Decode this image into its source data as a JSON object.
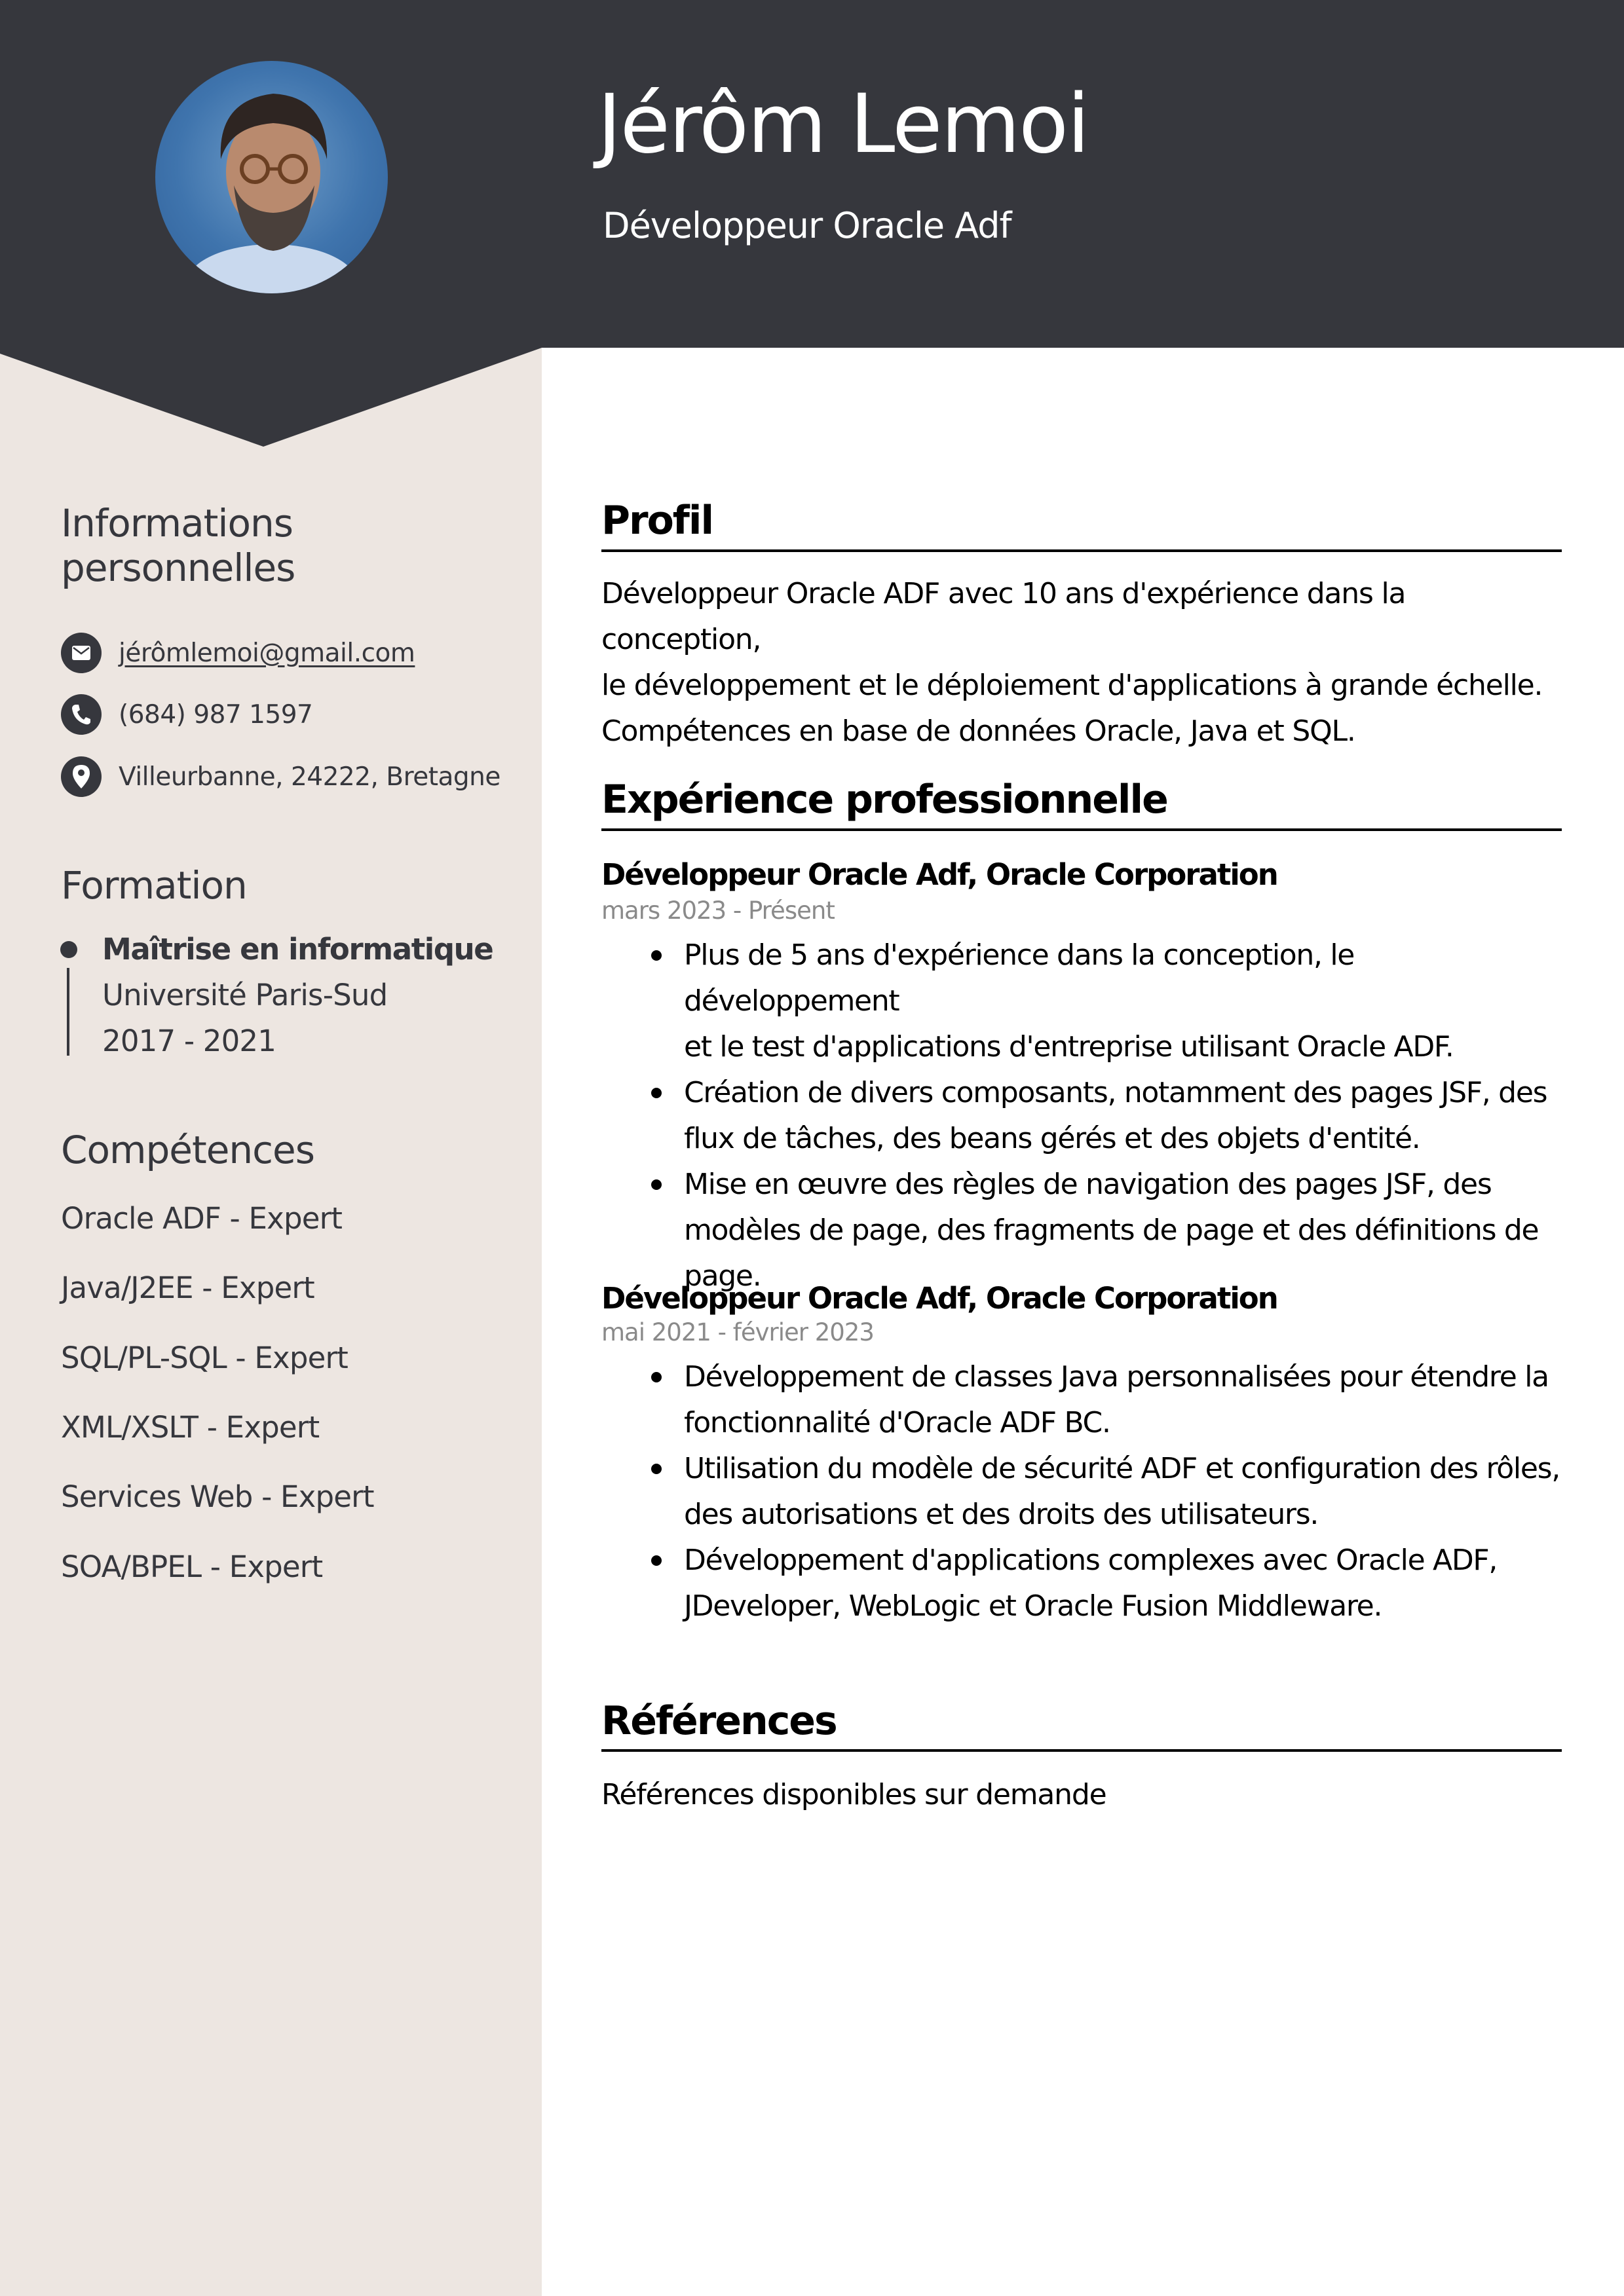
{
  "header": {
    "name": "Jérôm Lemoi",
    "title": "Développeur Oracle Adf",
    "photo_icon": "profile-photo"
  },
  "colors": {
    "header_bg": "#36373d",
    "sidebar_bg": "#ede6e1",
    "text_dark": "#36373d",
    "date_gray": "#8a8a8a"
  },
  "sidebar": {
    "personal": {
      "heading_line1": "Informations",
      "heading_line2": "personnelles",
      "email": {
        "icon": "envelope-icon",
        "value": "jérômlemoi@gmail.com"
      },
      "phone": {
        "icon": "phone-icon",
        "value": "(684) 987 1597"
      },
      "location": {
        "icon": "map-pin-icon",
        "value": "Villeurbanne, 24222, Bretagne"
      }
    },
    "education": {
      "heading": "Formation",
      "items": [
        {
          "degree": "Maîtrise en informatique",
          "school": "Université Paris-Sud",
          "years": "2017 - 2021"
        }
      ]
    },
    "skills": {
      "heading": "Compétences",
      "items": [
        "Oracle ADF - Expert",
        "Java/J2EE - Expert",
        "SQL/PL-SQL - Expert",
        "XML/XSLT - Expert",
        "Services Web - Expert",
        "SOA/BPEL - Expert"
      ]
    }
  },
  "main": {
    "profile": {
      "heading": "Profil",
      "lines": [
        "Développeur Oracle ADF avec 10 ans d'expérience dans la conception,",
        "le développement et le déploiement d'applications à grande échelle.",
        "Compétences en base de données Oracle, Java et SQL."
      ]
    },
    "experience": {
      "heading": "Expérience professionnelle",
      "jobs": [
        {
          "title": "Développeur Oracle Adf, Oracle Corporation",
          "dates": "mars 2023 - Présent",
          "bullets": [
            [
              "Plus de 5 ans d'expérience dans la conception, le développement",
              "et le test d'applications d'entreprise utilisant Oracle ADF."
            ],
            [
              "Création de divers composants, notamment des pages JSF, des",
              "flux de tâches, des beans gérés et des objets d'entité."
            ],
            [
              "Mise en œuvre des règles de navigation des pages JSF, des",
              "modèles de page, des fragments de page et des définitions de",
              "page."
            ]
          ]
        },
        {
          "title": "Développeur Oracle Adf, Oracle Corporation",
          "dates": "mai 2021 - février 2023",
          "bullets": [
            [
              "Développement de classes Java personnalisées pour étendre la",
              "fonctionnalité d'Oracle ADF BC."
            ],
            [
              "Utilisation du modèle de sécurité ADF et configuration des rôles,",
              "des autorisations et des droits des utilisateurs."
            ],
            [
              "Développement d'applications complexes avec Oracle ADF,",
              "JDeveloper, WebLogic et Oracle Fusion Middleware."
            ]
          ]
        }
      ]
    },
    "references": {
      "heading": "Références",
      "text": "Références disponibles sur demande"
    }
  }
}
